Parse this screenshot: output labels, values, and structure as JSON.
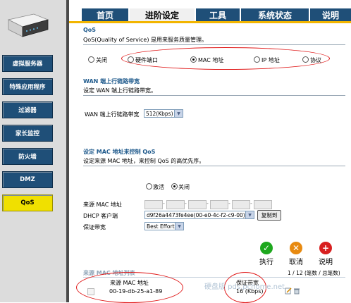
{
  "tabs": [
    {
      "label": "首页",
      "active": false
    },
    {
      "label": "进阶设定",
      "active": true
    },
    {
      "label": "工具",
      "active": false
    },
    {
      "label": "系统状态",
      "active": false
    },
    {
      "label": "说明",
      "active": false
    }
  ],
  "sidebar": {
    "items": [
      {
        "label": "虚拟服务器",
        "active": false
      },
      {
        "label": "特殊应用程序",
        "active": false
      },
      {
        "label": "过滤器",
        "active": false
      },
      {
        "label": "家长监控",
        "active": false
      },
      {
        "label": "防火墙",
        "active": false
      },
      {
        "label": "DMZ",
        "active": false
      },
      {
        "label": "QoS",
        "active": true
      }
    ]
  },
  "qos": {
    "title": "QoS",
    "description": "QoS(Quality of Service) 是用来服务质量管理。",
    "options": [
      "关闭",
      "硬件端口",
      "MAC 地址",
      "IP 地址",
      "协议"
    ],
    "selected": "MAC 地址"
  },
  "wan": {
    "title": "WAN 端上行链路带宽",
    "subtitle": "设定 WAN 端上行链路带宽。",
    "field_label": "WAN 端上行链路带宽",
    "value": "512(Kbps)"
  },
  "mac_qos": {
    "title": "设定 MAC 地址来控制 QoS",
    "subtitle": "设定来源 MAC 地址，来控制 QoS 的高优先序。",
    "enable_label": "激活",
    "disable_label": "关闭",
    "enabled": false,
    "source_mac_label": "来源 MAC 地址",
    "dhcp_label": "DHCP 客户端",
    "dhcp_value": "d9f26a4473fe4ee(00-e0-4c-f2-c9-00)",
    "copy_button": "复制到",
    "bandwidth_label": "保证带宽",
    "bandwidth_value": "Best Effort"
  },
  "actions": {
    "apply": "执行",
    "cancel": "取消",
    "help": "说明",
    "apply_color": "#1ea81e",
    "cancel_color": "#e88a10",
    "help_color": "#d82020"
  },
  "list": {
    "title": "来源 MAC 地址列表",
    "paging": "1 / 12 (笔数 / 总笔数)",
    "columns": [
      "来源 MAC 地址",
      "保证带宽"
    ],
    "rows": [
      {
        "mac": "00-19-db-25-a1-89",
        "bandwidth": "16 (Kbps)"
      }
    ]
  },
  "watermark": "硬盘版 pds.pchome.net"
}
